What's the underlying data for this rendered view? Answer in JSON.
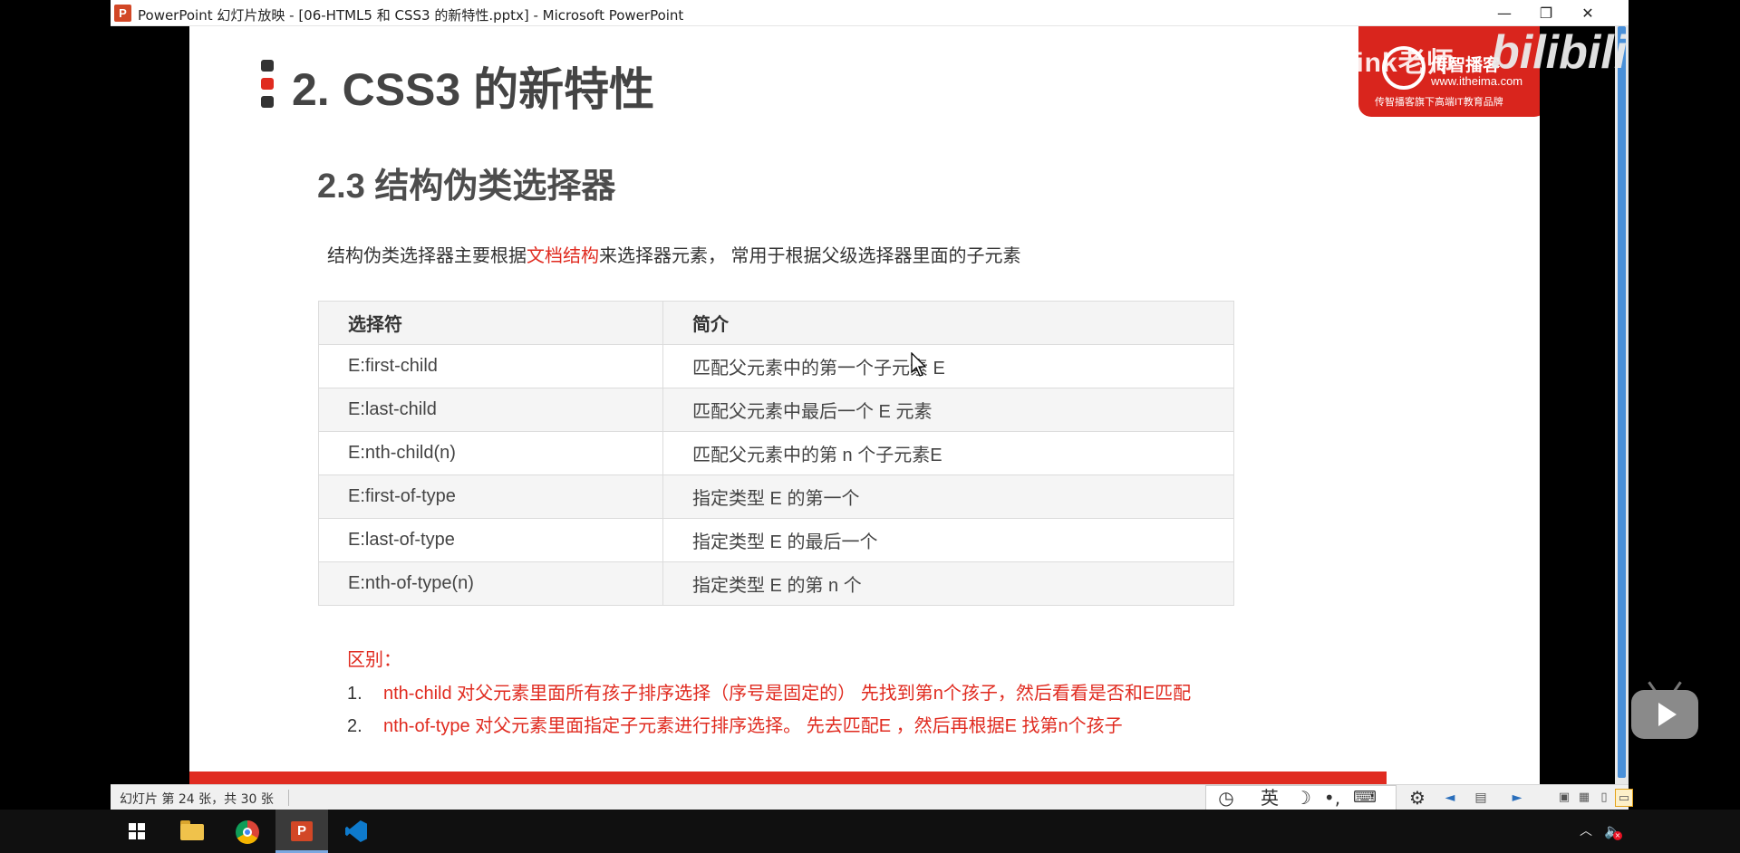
{
  "window": {
    "app_icon": "P",
    "title": "PowerPoint 幻灯片放映 - [06-HTML5 和 CSS3 的新特性.pptx] - Microsoft PowerPoint",
    "minimize_glyph": "—",
    "restore_glyph": "❐",
    "close_glyph": "✕"
  },
  "slide": {
    "heading": "2. CSS3 的新特性",
    "sub_heading": "2.3 结构伪类选择器",
    "intro": {
      "before": "结构伪类选择器主要根据",
      "highlight": "文档结构",
      "after": "来选择器元素， 常用于根据父级选择器里面的子元素"
    },
    "table": {
      "headers": [
        "选择符",
        "简介"
      ],
      "rows": [
        [
          "E:first-child",
          "匹配父元素中的第一个子元素 E"
        ],
        [
          "E:last-child",
          "匹配父元素中最后一个 E 元素"
        ],
        [
          "E:nth-child(n)",
          "匹配父元素中的第 n 个子元素E"
        ],
        [
          "E:first-of-type",
          "指定类型 E 的第一个"
        ],
        [
          "E:last-of-type",
          "指定类型 E 的最后一个"
        ],
        [
          "E:nth-of-type(n)",
          "指定类型 E 的第 n 个"
        ]
      ]
    },
    "difference": {
      "label": "区别：",
      "items": [
        {
          "num": "1.",
          "text": "nth-child 对父元素里面所有孩子排序选择（序号是固定的） 先找到第n个孩子，然后看看是否和E匹配"
        },
        {
          "num": "2.",
          "text": "nth-of-type 对父元素里面指定子元素进行排序选择。 先去匹配E ，然后再根据E 找第n个孩子"
        }
      ]
    },
    "accent_color": "#e02b20"
  },
  "brand": {
    "name": "传智播客",
    "url": "www.itheima.com",
    "tagline": "传智播客旗下高端IT教育品牌",
    "watermark": "黑马程序员pink老师",
    "bilibili": "bilibili"
  },
  "status_bar": {
    "slide_counter": "幻灯片 第 24 张，共 30 张",
    "ime": {
      "clock": "◷",
      "lang": "英",
      "moon": "☽",
      "punct": "•,",
      "keyboard": "⌨",
      "settings": "⚙"
    },
    "nav": {
      "prev": "◄",
      "menu": "▤",
      "next": "►"
    },
    "views": {
      "normal": "▣",
      "sorter": "▦",
      "reading": "▯",
      "slideshow": "▭"
    }
  },
  "taskbar": {
    "tray_chevron": "︿",
    "tray_volume": "🔈",
    "tray_mute": "×",
    "powerpoint_icon": "P"
  }
}
